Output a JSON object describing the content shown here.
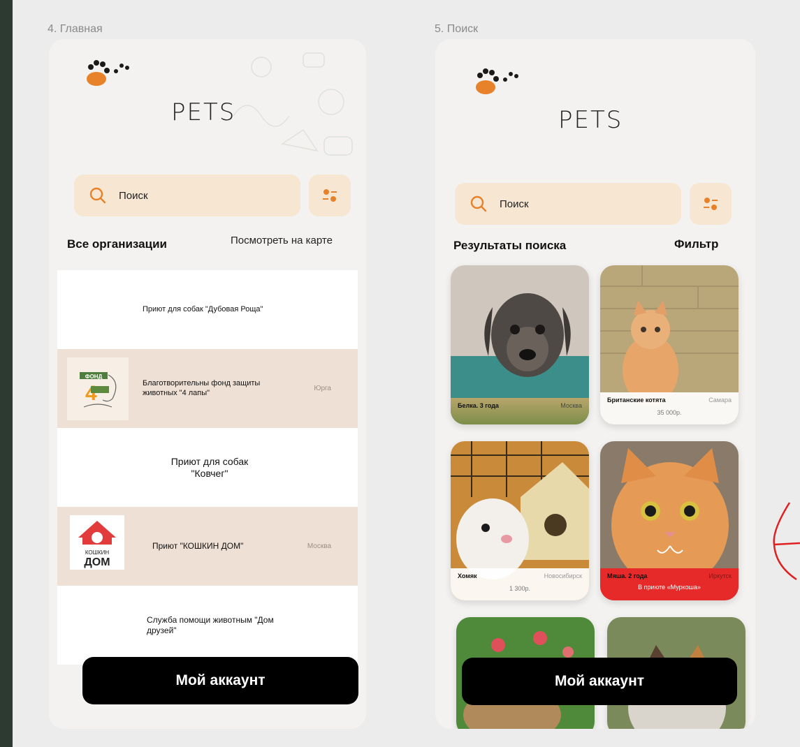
{
  "home": {
    "frame_label": "4. Главная",
    "brand": "PETS",
    "search_placeholder": "Поиск",
    "section_title": "Все организации",
    "map_link": "Посмотреть на карте",
    "organizations": [
      {
        "name": "Приют для собак \"Дубовая Роща\"",
        "city": ""
      },
      {
        "name": "Благотворительны фонд защиты животных \"4 лапы\"",
        "city": "Юрга",
        "logo_text": "ФОНД 4 ЛАПЫ"
      },
      {
        "name": "Приют для собак \"Ковчег\"",
        "city": ""
      },
      {
        "name": "Приют \"КОШКИН ДОМ\"",
        "city": "Москва",
        "logo_text_1": "КОШКИН",
        "logo_text_2": "ДОМ"
      },
      {
        "name": "Служба помощи животным \"Дом друзей\"",
        "city": ""
      }
    ],
    "account_button": "Мой аккаунт"
  },
  "search": {
    "frame_label": "5. Поиск",
    "brand": "PETS",
    "search_placeholder": "Поиск",
    "section_title": "Результаты поиска",
    "filter_link": "Фильтр",
    "pets": [
      {
        "name": "Белка. 3 года",
        "city": "Москва",
        "extra": ""
      },
      {
        "name": "Британские котята",
        "city": "Самара",
        "extra": "35 000р."
      },
      {
        "name": "Хомяк",
        "city": "Новосибирск",
        "extra": "1 300р."
      },
      {
        "name": "Мяша. 2 года",
        "city": "Иркутск",
        "extra": "В приюте «Муркоша»"
      }
    ],
    "account_button": "Мой аккаунт"
  },
  "colors": {
    "accent_beige": "#f6e6d2",
    "row_tan": "#efe0d5",
    "button_black": "#000000",
    "paw_orange": "#e8822a",
    "highlight_red": "#e62a2a"
  }
}
